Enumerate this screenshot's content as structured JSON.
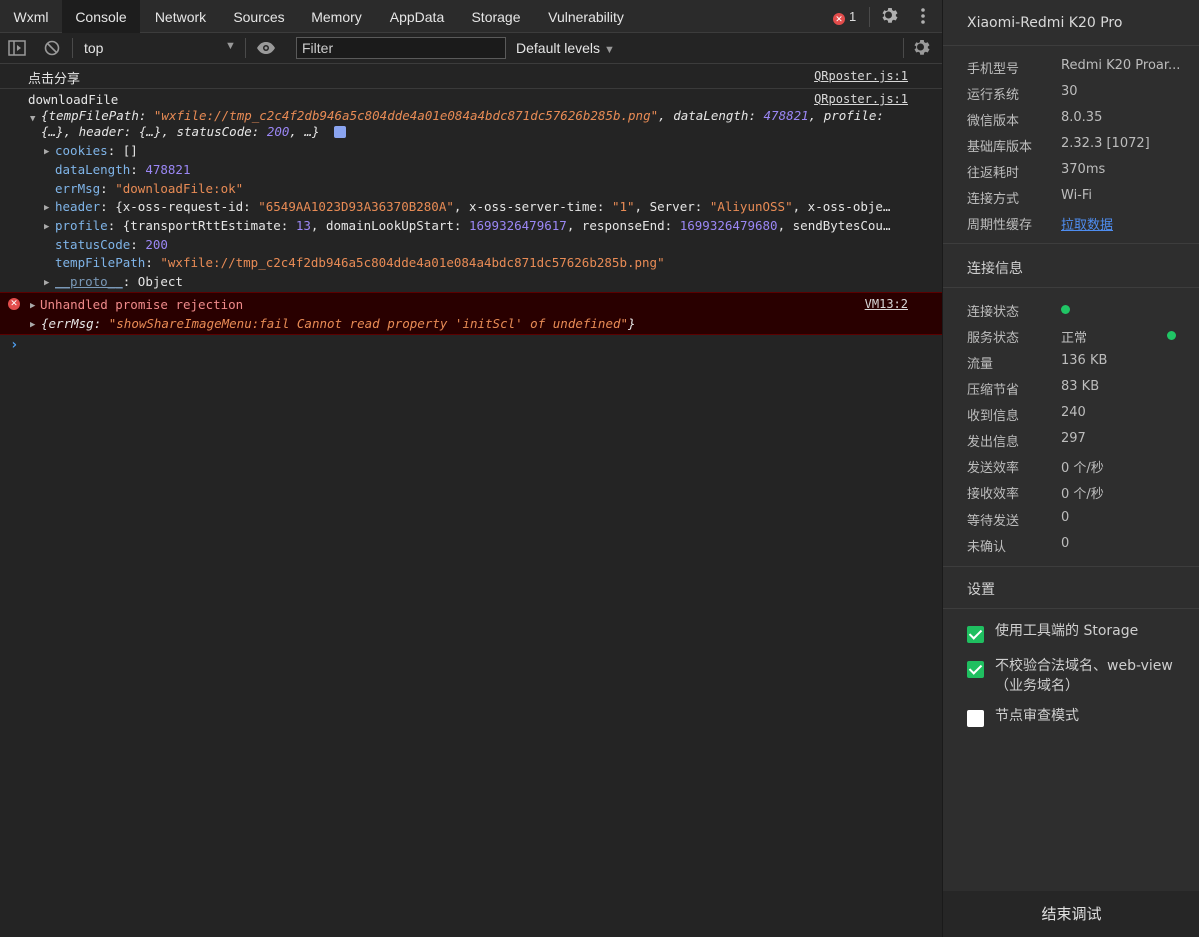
{
  "tabs": [
    {
      "label": "Wxml",
      "active": false
    },
    {
      "label": "Console",
      "active": true
    },
    {
      "label": "Network",
      "active": false
    },
    {
      "label": "Sources",
      "active": false
    },
    {
      "label": "Memory",
      "active": false
    },
    {
      "label": "AppData",
      "active": false
    },
    {
      "label": "Storage",
      "active": false
    },
    {
      "label": "Vulnerability",
      "active": false
    }
  ],
  "error_count": "1",
  "toolbar": {
    "context": "top",
    "filter_placeholder": "Filter",
    "levels": "Default levels"
  },
  "console": {
    "log1": {
      "text": "点击分享",
      "source": "QRposter.js:1"
    },
    "log2": {
      "label": "downloadFile",
      "source": "QRposter.js:1",
      "summary": {
        "k_tempFilePath": "tempFilePath",
        "v_tempFilePath": "\"wxfile://tmp_c2c4f2db946a5c804dde4a01e084a4bdc871dc57626b285b.png\"",
        "k_dataLength": "dataLength",
        "v_dataLength": "478821",
        "k_profile": "profile",
        "line2_a": "{…}",
        "k_header": "header",
        "line2_b": "{…}",
        "k_statusCode": "statusCode",
        "v_statusCode": "200",
        "tail": "…}"
      },
      "props": {
        "cookies_k": "cookies",
        "cookies_v": "[]",
        "dataLength_k": "dataLength",
        "dataLength_v": "478821",
        "errMsg_k": "errMsg",
        "errMsg_v": "\"downloadFile:ok\"",
        "header_k": "header",
        "header_id_k": "x-oss-request-id",
        "header_id_v": "\"6549AA1023D93A36370B280A\"",
        "header_time_k": "x-oss-server-time",
        "header_time_v": "\"1\"",
        "header_server_k": "Server",
        "header_server_v": "\"AliyunOSS\"",
        "header_tail": "x-oss-obje…",
        "profile_k": "profile",
        "profile_rtt_k": "transportRttEstimate",
        "profile_rtt_v": "13",
        "profile_dls_k": "domainLookUpStart",
        "profile_dls_v": "1699326479617",
        "profile_re_k": "responseEnd",
        "profile_re_v": "1699326479680",
        "profile_tail": "sendBytesCou…",
        "statusCode_k": "statusCode",
        "statusCode_v": "200",
        "tempFilePath_k": "tempFilePath",
        "tempFilePath_v": "\"wxfile://tmp_c2c4f2db946a5c804dde4a01e084a4bdc871dc57626b285b.png\"",
        "proto_k": "__proto__",
        "proto_v": "Object"
      }
    },
    "error": {
      "title": "Unhandled promise rejection",
      "source": "VM13:2",
      "errMsg_k": "errMsg",
      "errMsg_v": "\"showShareImageMenu:fail Cannot read property 'initScl' of undefined\""
    }
  },
  "panel": {
    "device": "Xiaomi-Redmi K20 Pro",
    "info": [
      {
        "label": "手机型号",
        "value": "Redmi K20 Proar..."
      },
      {
        "label": "运行系统",
        "value": "30"
      },
      {
        "label": "微信版本",
        "value": "8.0.35"
      },
      {
        "label": "基础库版本",
        "value": "2.32.3 [1072]"
      },
      {
        "label": "往返耗时",
        "value": "370ms"
      },
      {
        "label": "连接方式",
        "value": "Wi-Fi"
      },
      {
        "label": "周期性缓存",
        "value": "拉取数据"
      }
    ],
    "conn_title": "连接信息",
    "conn": [
      {
        "label": "连接状态",
        "value": ""
      },
      {
        "label": "服务状态",
        "value": "正常"
      },
      {
        "label": "流量",
        "value": "136 KB"
      },
      {
        "label": "压缩节省",
        "value": "83 KB"
      },
      {
        "label": "收到信息",
        "value": "240"
      },
      {
        "label": "发出信息",
        "value": "297"
      },
      {
        "label": "发送效率",
        "value": "0 个/秒"
      },
      {
        "label": "接收效率",
        "value": "0 个/秒"
      },
      {
        "label": "等待发送",
        "value": "0"
      },
      {
        "label": "未确认",
        "value": "0"
      }
    ],
    "settings_title": "设置",
    "settings": [
      {
        "label": "使用工具端的 Storage",
        "checked": true
      },
      {
        "label": "不校验合法域名、web-view（业务域名）",
        "checked": true
      },
      {
        "label": "节点审查模式",
        "checked": false
      }
    ],
    "end_button": "结束调试",
    "status_color": "#20c565"
  }
}
